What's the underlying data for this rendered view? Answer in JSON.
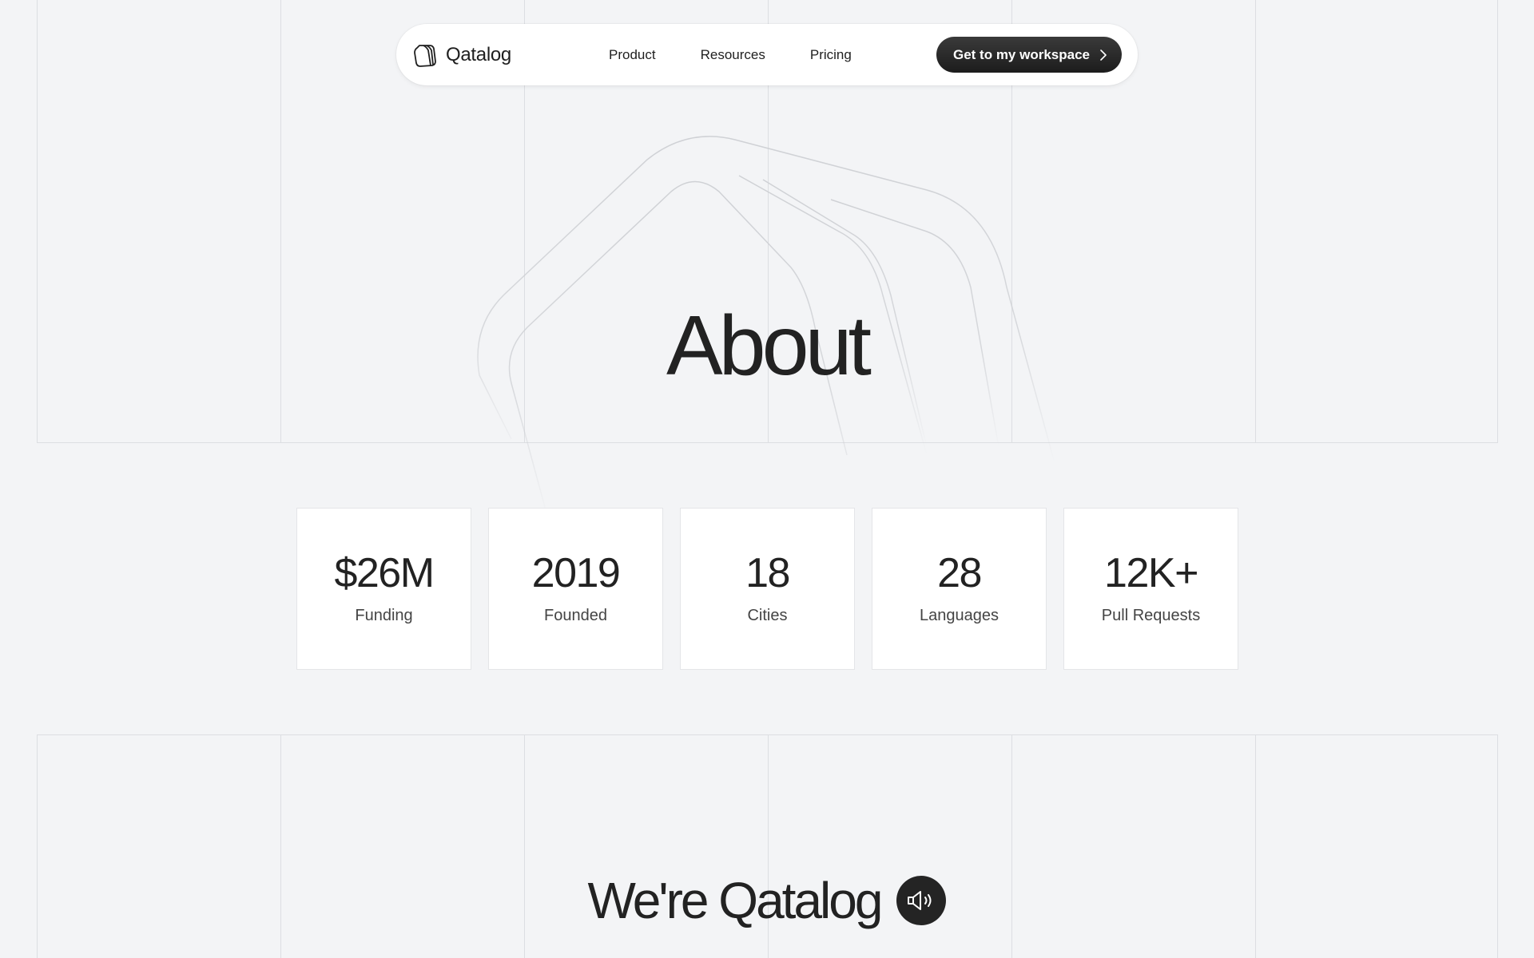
{
  "brand": {
    "name": "Qatalog",
    "logo_icon": "qatalog-logo-icon"
  },
  "nav": {
    "links": [
      {
        "label": "Product"
      },
      {
        "label": "Resources"
      },
      {
        "label": "Pricing"
      }
    ],
    "cta_label": "Get to my workspace",
    "cta_icon": "chevron-right-icon"
  },
  "hero": {
    "title": "About"
  },
  "stats": [
    {
      "value": "$26M",
      "label": "Funding"
    },
    {
      "value": "2019",
      "label": "Founded"
    },
    {
      "value": "18",
      "label": "Cities"
    },
    {
      "value": "28",
      "label": "Languages"
    },
    {
      "value": "12K+",
      "label": "Pull Requests"
    }
  ],
  "intro": {
    "title": "We're Qatalog",
    "sound_icon": "speaker-icon"
  },
  "colors": {
    "background": "#f3f4f6",
    "cta_background": "#242424",
    "text": "#222222"
  }
}
